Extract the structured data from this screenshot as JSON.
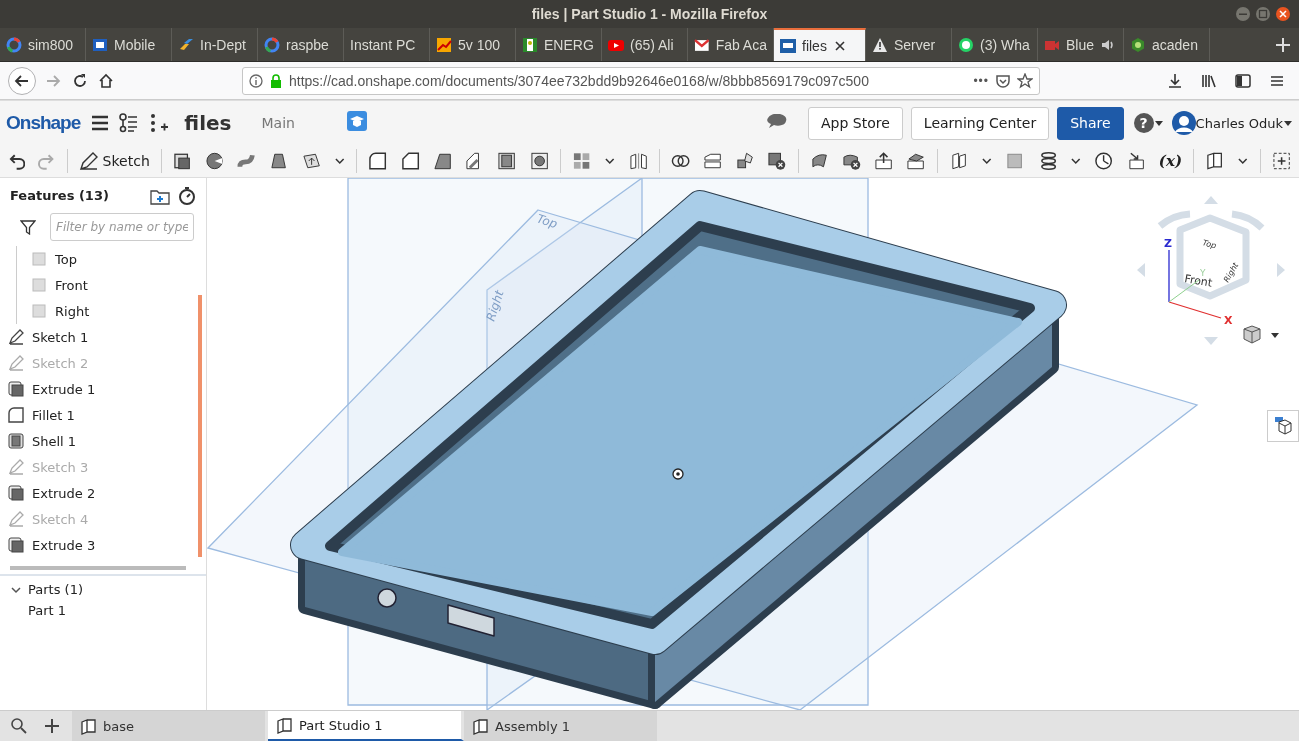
{
  "window": {
    "title": "files | Part Studio 1 - Mozilla Firefox"
  },
  "browser_tabs": [
    {
      "label": "sim800",
      "selected": false,
      "playing": false
    },
    {
      "label": "Mobile",
      "selected": false,
      "playing": false
    },
    {
      "label": "In-Dept",
      "selected": false,
      "playing": false
    },
    {
      "label": "raspbe",
      "selected": false,
      "playing": false
    },
    {
      "label": "Instant PC",
      "selected": false,
      "playing": false
    },
    {
      "label": "5v 100",
      "selected": false,
      "playing": false
    },
    {
      "label": "ENERG",
      "selected": false,
      "playing": false
    },
    {
      "label": "(65) Ali",
      "selected": false,
      "playing": false
    },
    {
      "label": "Fab Aca",
      "selected": false,
      "playing": false
    },
    {
      "label": "files",
      "selected": true,
      "playing": false
    },
    {
      "label": "Server",
      "selected": false,
      "playing": false
    },
    {
      "label": "(3) Wha",
      "selected": false,
      "playing": false
    },
    {
      "label": "Blue",
      "selected": false,
      "playing": true
    },
    {
      "label": "acaden",
      "selected": false,
      "playing": false
    }
  ],
  "address_bar": {
    "url": "https://cad.onshape.com/documents/3074ee732bdd9b92646e0168/w/8bbb8569179c097c500",
    "more": "•••"
  },
  "header": {
    "logo": "Onshape",
    "document": "files",
    "branch": "Main",
    "buttons": [
      "App Store",
      "Learning Center",
      "Share"
    ],
    "help": "?",
    "user": "Charles Oduk"
  },
  "toolbar": {
    "sketch": "Sketch",
    "variable": "(x)"
  },
  "features": {
    "title": "Features (13)",
    "filter_placeholder": "Filter by name or type",
    "items": [
      {
        "label": "Top",
        "kind": "plane",
        "hidden": false
      },
      {
        "label": "Front",
        "kind": "plane",
        "hidden": false
      },
      {
        "label": "Right",
        "kind": "plane",
        "hidden": false
      },
      {
        "label": "Sketch 1",
        "kind": "sketch",
        "hidden": false
      },
      {
        "label": "Sketch 2",
        "kind": "sketch",
        "hidden": true
      },
      {
        "label": "Extrude 1",
        "kind": "extrude",
        "hidden": false
      },
      {
        "label": "Fillet 1",
        "kind": "fillet",
        "hidden": false
      },
      {
        "label": "Shell 1",
        "kind": "shell",
        "hidden": false
      },
      {
        "label": "Sketch 3",
        "kind": "sketch",
        "hidden": true
      },
      {
        "label": "Extrude 2",
        "kind": "extrude",
        "hidden": false
      },
      {
        "label": "Sketch 4",
        "kind": "sketch",
        "hidden": true
      },
      {
        "label": "Extrude 3",
        "kind": "extrude",
        "hidden": false
      }
    ],
    "parts": {
      "label": "Parts (1)",
      "expanded": true,
      "items": [
        "Part 1"
      ]
    }
  },
  "viewport": {
    "plane_labels": [
      "Top",
      "Right"
    ],
    "view_cube": {
      "faces": [
        "Top",
        "Front",
        "Right"
      ],
      "axes": [
        "X",
        "Y",
        "Z"
      ]
    }
  },
  "bottom_tabs": [
    {
      "label": "base",
      "selected": false
    },
    {
      "label": "Part Studio 1",
      "selected": true
    },
    {
      "label": "Assembly 1",
      "selected": false
    }
  ]
}
